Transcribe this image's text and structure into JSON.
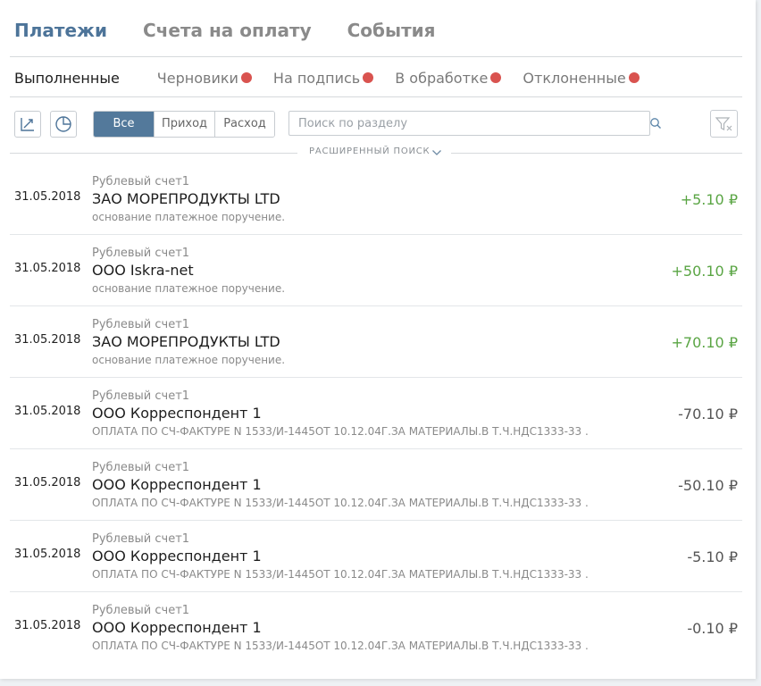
{
  "tabs": [
    {
      "label": "Платежи",
      "active": true
    },
    {
      "label": "Счета на оплату",
      "active": false
    },
    {
      "label": "События",
      "active": false
    }
  ],
  "subtabs": [
    {
      "label": "Выполненные",
      "active": true,
      "badge": false
    },
    {
      "label": "Черновики",
      "active": false,
      "badge": true
    },
    {
      "label": "На подпись",
      "active": false,
      "badge": true
    },
    {
      "label": "В обработке",
      "active": false,
      "badge": true
    },
    {
      "label": "Отклоненные",
      "active": false,
      "badge": true
    }
  ],
  "toolbar": {
    "segments": [
      {
        "label": "Все",
        "active": true
      },
      {
        "label": "Приход",
        "active": false
      },
      {
        "label": "Расход",
        "active": false
      }
    ],
    "search_placeholder": "Поиск по разделу",
    "advanced_search_label": "РАСШИРЕННЫЙ ПОИСК",
    "icons": [
      "trend-chart-icon",
      "pie-chart-icon",
      "search-icon",
      "filter-clear-icon",
      "chevron-down-icon"
    ]
  },
  "payments": [
    {
      "date": "31.05.2018",
      "account": "Рублевый счет1",
      "name": "ЗАО МОРЕПРОДУКТЫ LTD",
      "description": "основание платежное поручение.",
      "amount": "+5.10 ₽",
      "direction": "in"
    },
    {
      "date": "31.05.2018",
      "account": "Рублевый счет1",
      "name": "ООО Iskra-net",
      "description": "основание платежное поручение.",
      "amount": "+50.10 ₽",
      "direction": "in"
    },
    {
      "date": "31.05.2018",
      "account": "Рублевый счет1",
      "name": "ЗАО МОРЕПРОДУКТЫ LTD",
      "description": "основание платежное поручение.",
      "amount": "+70.10 ₽",
      "direction": "in"
    },
    {
      "date": "31.05.2018",
      "account": "Рублевый счет1",
      "name": "ООО Корреспондент 1",
      "description": "ОПЛАТА ПО СЧ-ФАКТУРЕ N 1533/И-1445ОТ 10.12.04Г.ЗА МАТЕРИАЛЫ.В Т.Ч.НДС1333-33 .",
      "amount": "-70.10 ₽",
      "direction": "out"
    },
    {
      "date": "31.05.2018",
      "account": "Рублевый счет1",
      "name": "ООО Корреспондент 1",
      "description": "ОПЛАТА ПО СЧ-ФАКТУРЕ N 1533/И-1445ОТ 10.12.04Г.ЗА МАТЕРИАЛЫ.В Т.Ч.НДС1333-33 .",
      "amount": "-50.10 ₽",
      "direction": "out"
    },
    {
      "date": "31.05.2018",
      "account": "Рублевый счет1",
      "name": "ООО Корреспондент 1",
      "description": "ОПЛАТА ПО СЧ-ФАКТУРЕ N 1533/И-1445ОТ 10.12.04Г.ЗА МАТЕРИАЛЫ.В Т.Ч.НДС1333-33 .",
      "amount": "-5.10 ₽",
      "direction": "out"
    },
    {
      "date": "31.05.2018",
      "account": "Рублевый счет1",
      "name": "ООО Корреспондент 1",
      "description": "ОПЛАТА ПО СЧ-ФАКТУРЕ N 1533/И-1445ОТ 10.12.04Г.ЗА МАТЕРИАЛЫ.В Т.Ч.НДС1333-33 .",
      "amount": "-0.10 ₽",
      "direction": "out"
    }
  ],
  "colors": {
    "accent": "#53799b",
    "tab_active": "#4d7499",
    "positive": "#5aa544",
    "badge": "#d9534f"
  }
}
